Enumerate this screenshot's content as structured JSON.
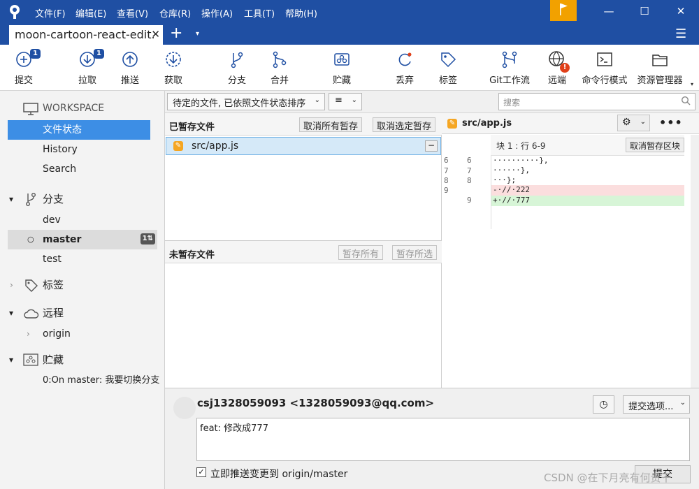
{
  "menubar": {
    "items": [
      "文件(F)",
      "编辑(E)",
      "查看(V)",
      "仓库(R)",
      "操作(A)",
      "工具(T)",
      "帮助(H)"
    ],
    "window_controls": [
      "—",
      "☐",
      "✕"
    ]
  },
  "tabbar": {
    "repo_tab": "moon-cartoon-react-edit.",
    "close": "✕",
    "new_tab": "+",
    "dropdown": "▾",
    "menu": "☰"
  },
  "toolbar": {
    "items": [
      {
        "label": "提交",
        "icon": "commit-icon",
        "badge": "1"
      },
      {
        "label": "拉取",
        "icon": "pull-icon",
        "badge": "1"
      },
      {
        "label": "推送",
        "icon": "push-icon"
      },
      {
        "label": "获取",
        "icon": "fetch-icon"
      },
      {
        "label": "分支",
        "icon": "branch-icon"
      },
      {
        "label": "合并",
        "icon": "merge-icon"
      },
      {
        "label": "贮藏",
        "icon": "stash-icon"
      },
      {
        "label": "丢弃",
        "icon": "discard-icon"
      },
      {
        "label": "标签",
        "icon": "tag-icon"
      },
      {
        "label": "Git工作流",
        "icon": "git-flow-icon"
      },
      {
        "label": "远端",
        "icon": "remote-icon",
        "alert": "!"
      },
      {
        "label": "命令行模式",
        "icon": "terminal-icon"
      },
      {
        "label": "资源管理器",
        "icon": "explorer-icon"
      }
    ],
    "overflow": "▾"
  },
  "sidebar": {
    "workspace": {
      "title": "WORKSPACE",
      "items": [
        "文件状态",
        "History",
        "Search"
      ],
      "selected": "文件状态"
    },
    "branches": {
      "title": "分支",
      "items": [
        "dev",
        "master",
        "test"
      ],
      "current": "master",
      "current_badge": "1⇅"
    },
    "tags": {
      "title": "标签"
    },
    "remotes": {
      "title": "远程",
      "items": [
        "origin"
      ]
    },
    "stashes": {
      "title": "贮藏",
      "items": [
        "0:On master: 我要切换分支"
      ]
    }
  },
  "filter": {
    "sort_label": "待定的文件, 已依照文件状态排序",
    "view_icon": "≡",
    "search_placeholder": "搜索"
  },
  "staged": {
    "title": "已暂存文件",
    "btn_unstage_all": "取消所有暂存",
    "btn_unstage_selected": "取消选定暂存",
    "files": [
      "src/app.js"
    ]
  },
  "unstaged": {
    "title": "未暂存文件",
    "btn_stage_all": "暂存所有",
    "btn_stage_selected": "暂存所选"
  },
  "diff": {
    "file": "src/app.js",
    "hunk_label": "块 1 : 行 6-9",
    "btn_unstage_hunk": "取消暂存区块",
    "more": "•••",
    "lines": [
      {
        "old": "6",
        "new": "6",
        "text": "··········},",
        "type": "ctx"
      },
      {
        "old": "7",
        "new": "7",
        "text": "······},",
        "type": "ctx"
      },
      {
        "old": "8",
        "new": "8",
        "text": "···};",
        "type": "ctx"
      },
      {
        "old": "9",
        "new": "",
        "text": "-·//·222",
        "type": "del"
      },
      {
        "old": "",
        "new": "9",
        "text": "+·//·777",
        "type": "add"
      }
    ]
  },
  "commit": {
    "author": "csj1328059093 <1328059093@qq.com>",
    "options": "提交选项...",
    "message": "feat: 修改成777",
    "push_label": "立即推送变更到 origin/master",
    "push_checked": true,
    "commit_button": "提交"
  },
  "watermark": "CSDN @在下月亮有何贵干"
}
